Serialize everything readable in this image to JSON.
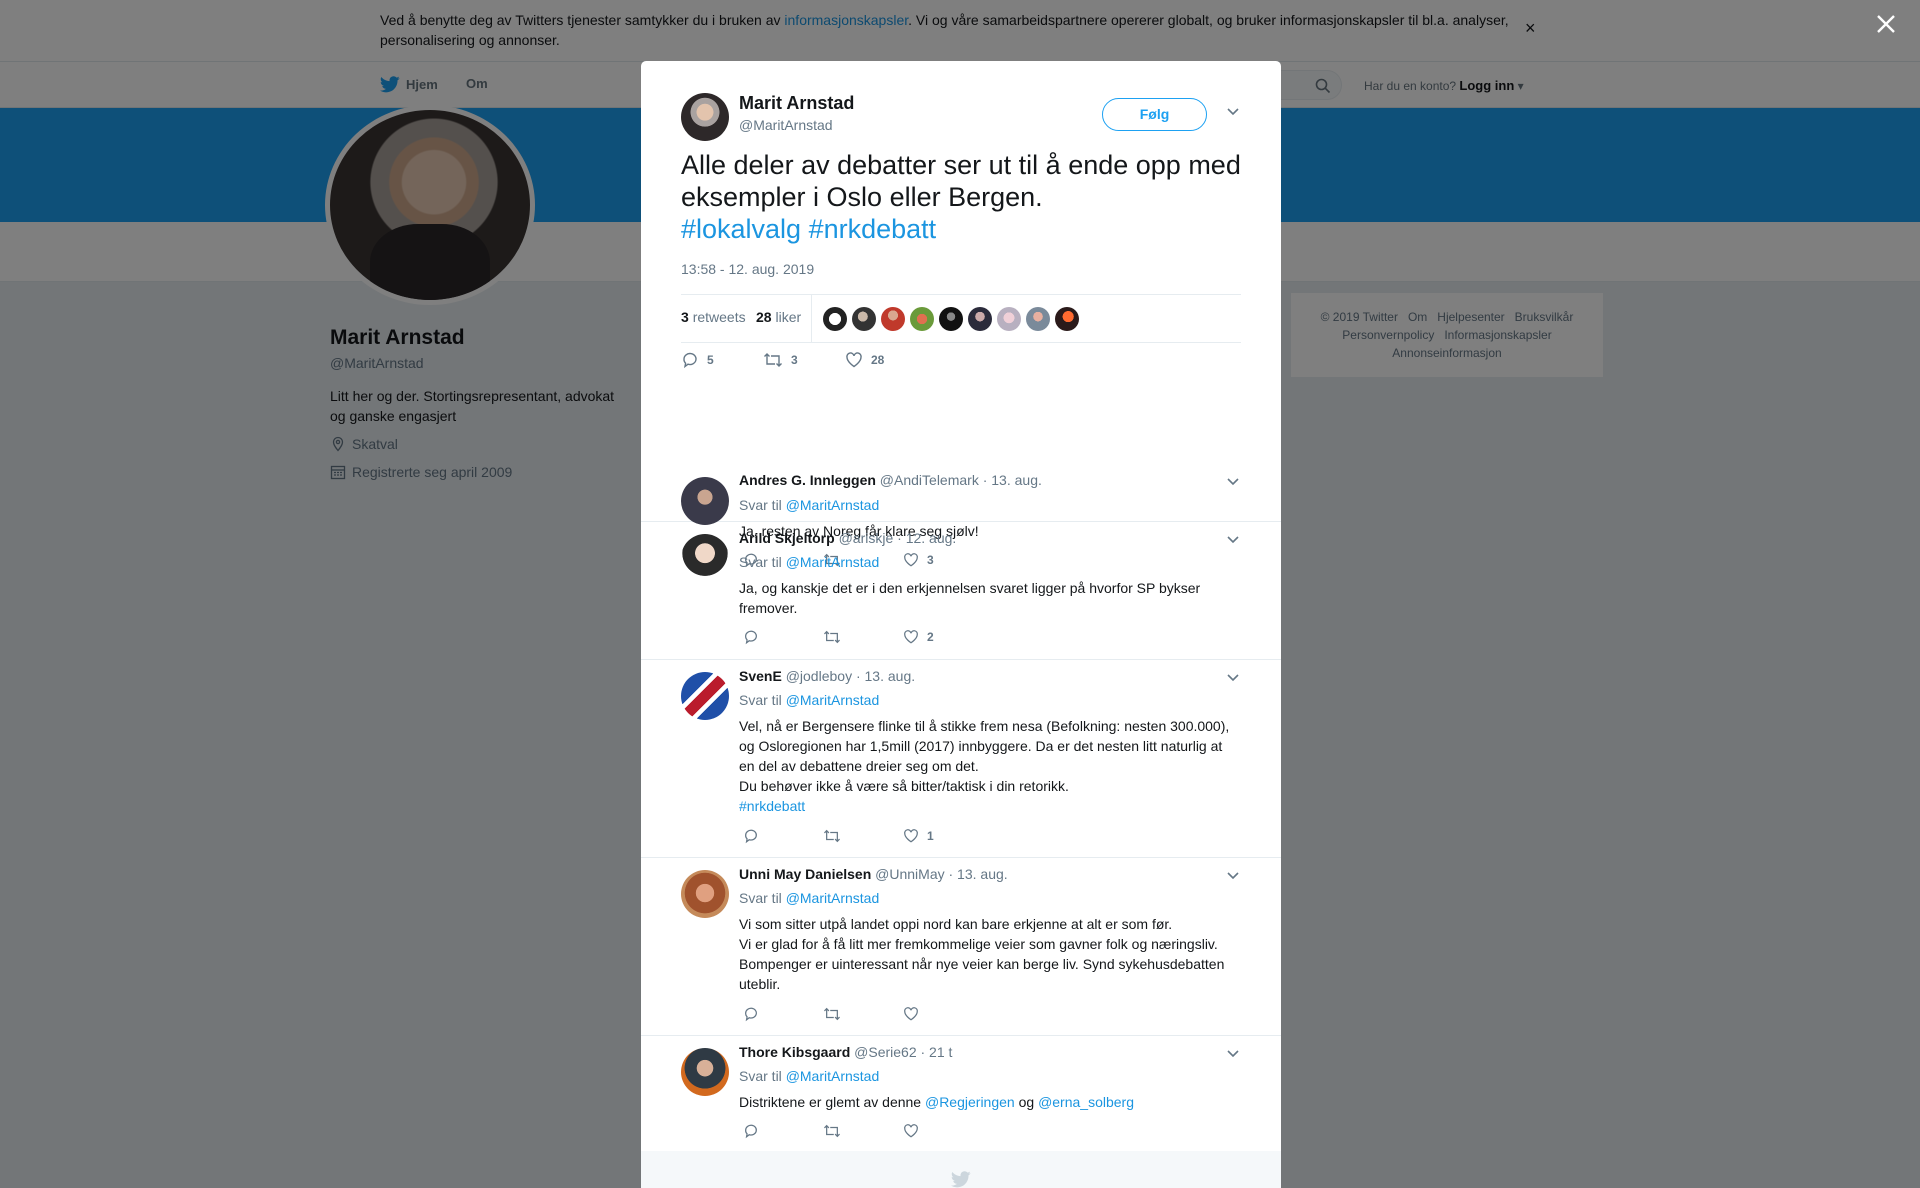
{
  "cookie": {
    "text_before": "Ved å benytte deg av Twitters tjenester samtykker du i bruken av ",
    "link": "informasjonskapsler",
    "text_after": ". Vi og våre samarbeidspartnere opererer globalt, og bruker informasjonskapsler til bl.a. analyser, personalisering og annonser.",
    "close": "×"
  },
  "nav": {
    "home": "Hjem",
    "about": "Om",
    "login_question": "Har du en konto?",
    "login_link": "Logg inn"
  },
  "profile": {
    "name": "Marit Arnstad",
    "handle": "@MaritArnstad",
    "bio": "Litt her og der. Stortingsrepresentant, advokat og ganske engasjert",
    "location": "Skatval",
    "joined": "Registrerte seg april 2009"
  },
  "footer": {
    "copyright": "© 2019 Twitter",
    "about": "Om",
    "help": "Hjelpesenter",
    "terms": "Bruksvilkår",
    "privacy": "Personvernpolicy",
    "cookies": "Informasjonskapsler",
    "ads": "Annonseinformasjon"
  },
  "tweet": {
    "name": "Marit Arnstad",
    "handle": "@MaritArnstad",
    "follow": "Følg",
    "text": "Alle deler av debatter ser ut til å ende opp med eksempler i Oslo eller Bergen.",
    "hashtag1": "#lokalvalg",
    "hashtag2": "#nrkdebatt",
    "time": "13:58 - 12. aug. 2019",
    "retweets_count": "3",
    "retweets_label": "retweets",
    "likes_count": "28",
    "likes_label": "liker",
    "action_reply": "5",
    "action_retweet": "3",
    "action_like": "28"
  },
  "replies": [
    {
      "name": "Andres G. Innleggen",
      "handle": "@AndiTelemark",
      "date": "· 13. aug.",
      "reply_to_label": "Svar til",
      "reply_to": "@MaritArnstad",
      "text": "Ja, resten av Noreg får klare seg sjølv!",
      "likes": "3"
    },
    {
      "name": "Arild Skjeltorp",
      "handle": "@ariskje",
      "date": "· 12. aug.",
      "reply_to_label": "Svar til",
      "reply_to": "@MaritArnstad",
      "text": "Ja, og kanskje det er i den erkjennelsen svaret ligger på hvorfor SP bykser fremover.",
      "likes": "2"
    },
    {
      "name": "SvenE",
      "handle": "@jodleboy",
      "date": "· 13. aug.",
      "reply_to_label": "Svar til",
      "reply_to": "@MaritArnstad",
      "text_line1": "Vel, nå er Bergensere flinke til å stikke frem nesa (Befolkning: nesten 300.000), og Osloregionen har 1,5mill (2017) innbyggere. Da er det nesten litt naturlig at en del av debattene dreier seg om det.",
      "text_line2": "Du behøver ikke å være så bitter/taktisk i din retorikk.",
      "hashtag": "#nrkdebatt",
      "likes": "1"
    },
    {
      "name": "Unni May Danielsen",
      "handle": "@UnniMay",
      "date": "· 13. aug.",
      "reply_to_label": "Svar til",
      "reply_to": "@MaritArnstad",
      "text_line1": "Vi som sitter utpå landet oppi nord kan bare erkjenne at alt er som før.",
      "text_line2": "Vi er glad for å få litt mer fremkommelige veier som gavner folk og næringsliv. Bompenger er uinteressant når nye veier kan berge liv. Synd sykehusdebatten uteblir."
    },
    {
      "name": "Thore Kibsgaard",
      "handle": "@Serie62",
      "date": "· 21 t",
      "reply_to_label": "Svar til",
      "reply_to": "@MaritArnstad",
      "text_before": "Distriktene er glemt av denne",
      "mention1": "@Regjeringen",
      "text_mid": "og",
      "mention2": "@erna_solberg"
    }
  ],
  "colors": {
    "brand": "#1da1f2",
    "link": "#1b95e0",
    "text": "#14171a",
    "muted": "#657786"
  },
  "icons": [
    "twitter-bird-icon",
    "search-icon",
    "close-icon",
    "location-icon",
    "calendar-icon",
    "chevron-down-icon",
    "reply-icon",
    "retweet-icon",
    "heart-icon"
  ]
}
